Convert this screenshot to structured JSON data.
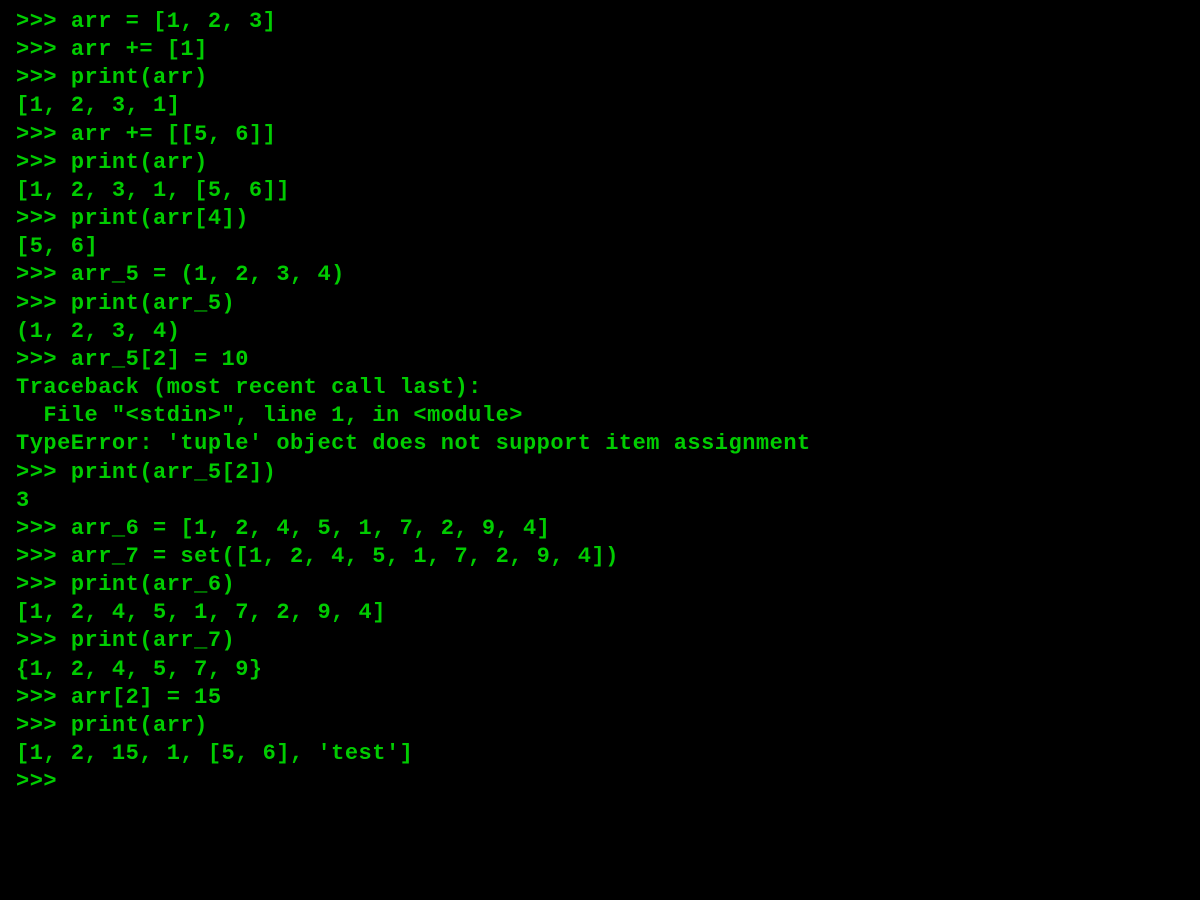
{
  "terminal": {
    "prompt": ">>> ",
    "lines": [
      {
        "type": "input",
        "text": "arr = [1, 2, 3]"
      },
      {
        "type": "input",
        "text": "arr += [1]"
      },
      {
        "type": "input",
        "text": "print(arr)"
      },
      {
        "type": "output",
        "text": "[1, 2, 3, 1]"
      },
      {
        "type": "input",
        "text": "arr += [[5, 6]]"
      },
      {
        "type": "input",
        "text": "print(arr)"
      },
      {
        "type": "output",
        "text": "[1, 2, 3, 1, [5, 6]]"
      },
      {
        "type": "input",
        "text": "print(arr[4])"
      },
      {
        "type": "output",
        "text": "[5, 6]"
      },
      {
        "type": "input",
        "text": "arr_5 = (1, 2, 3, 4)"
      },
      {
        "type": "input",
        "text": "print(arr_5)"
      },
      {
        "type": "output",
        "text": "(1, 2, 3, 4)"
      },
      {
        "type": "input",
        "text": "arr_5[2] = 10"
      },
      {
        "type": "output",
        "text": "Traceback (most recent call last):"
      },
      {
        "type": "output",
        "text": "  File \"<stdin>\", line 1, in <module>"
      },
      {
        "type": "output",
        "text": "TypeError: 'tuple' object does not support item assignment"
      },
      {
        "type": "input",
        "text": "print(arr_5[2])"
      },
      {
        "type": "output",
        "text": "3"
      },
      {
        "type": "input",
        "text": "arr_6 = [1, 2, 4, 5, 1, 7, 2, 9, 4]"
      },
      {
        "type": "input",
        "text": "arr_7 = set([1, 2, 4, 5, 1, 7, 2, 9, 4])"
      },
      {
        "type": "input",
        "text": "print(arr_6)"
      },
      {
        "type": "output",
        "text": "[1, 2, 4, 5, 1, 7, 2, 9, 4]"
      },
      {
        "type": "input",
        "text": "print(arr_7)"
      },
      {
        "type": "output",
        "text": "{1, 2, 4, 5, 7, 9}"
      },
      {
        "type": "input",
        "text": "arr[2] = 15"
      },
      {
        "type": "input",
        "text": "print(arr)"
      },
      {
        "type": "output",
        "text": "[1, 2, 15, 1, [5, 6], 'test']"
      },
      {
        "type": "prompt-only",
        "text": ""
      }
    ]
  }
}
